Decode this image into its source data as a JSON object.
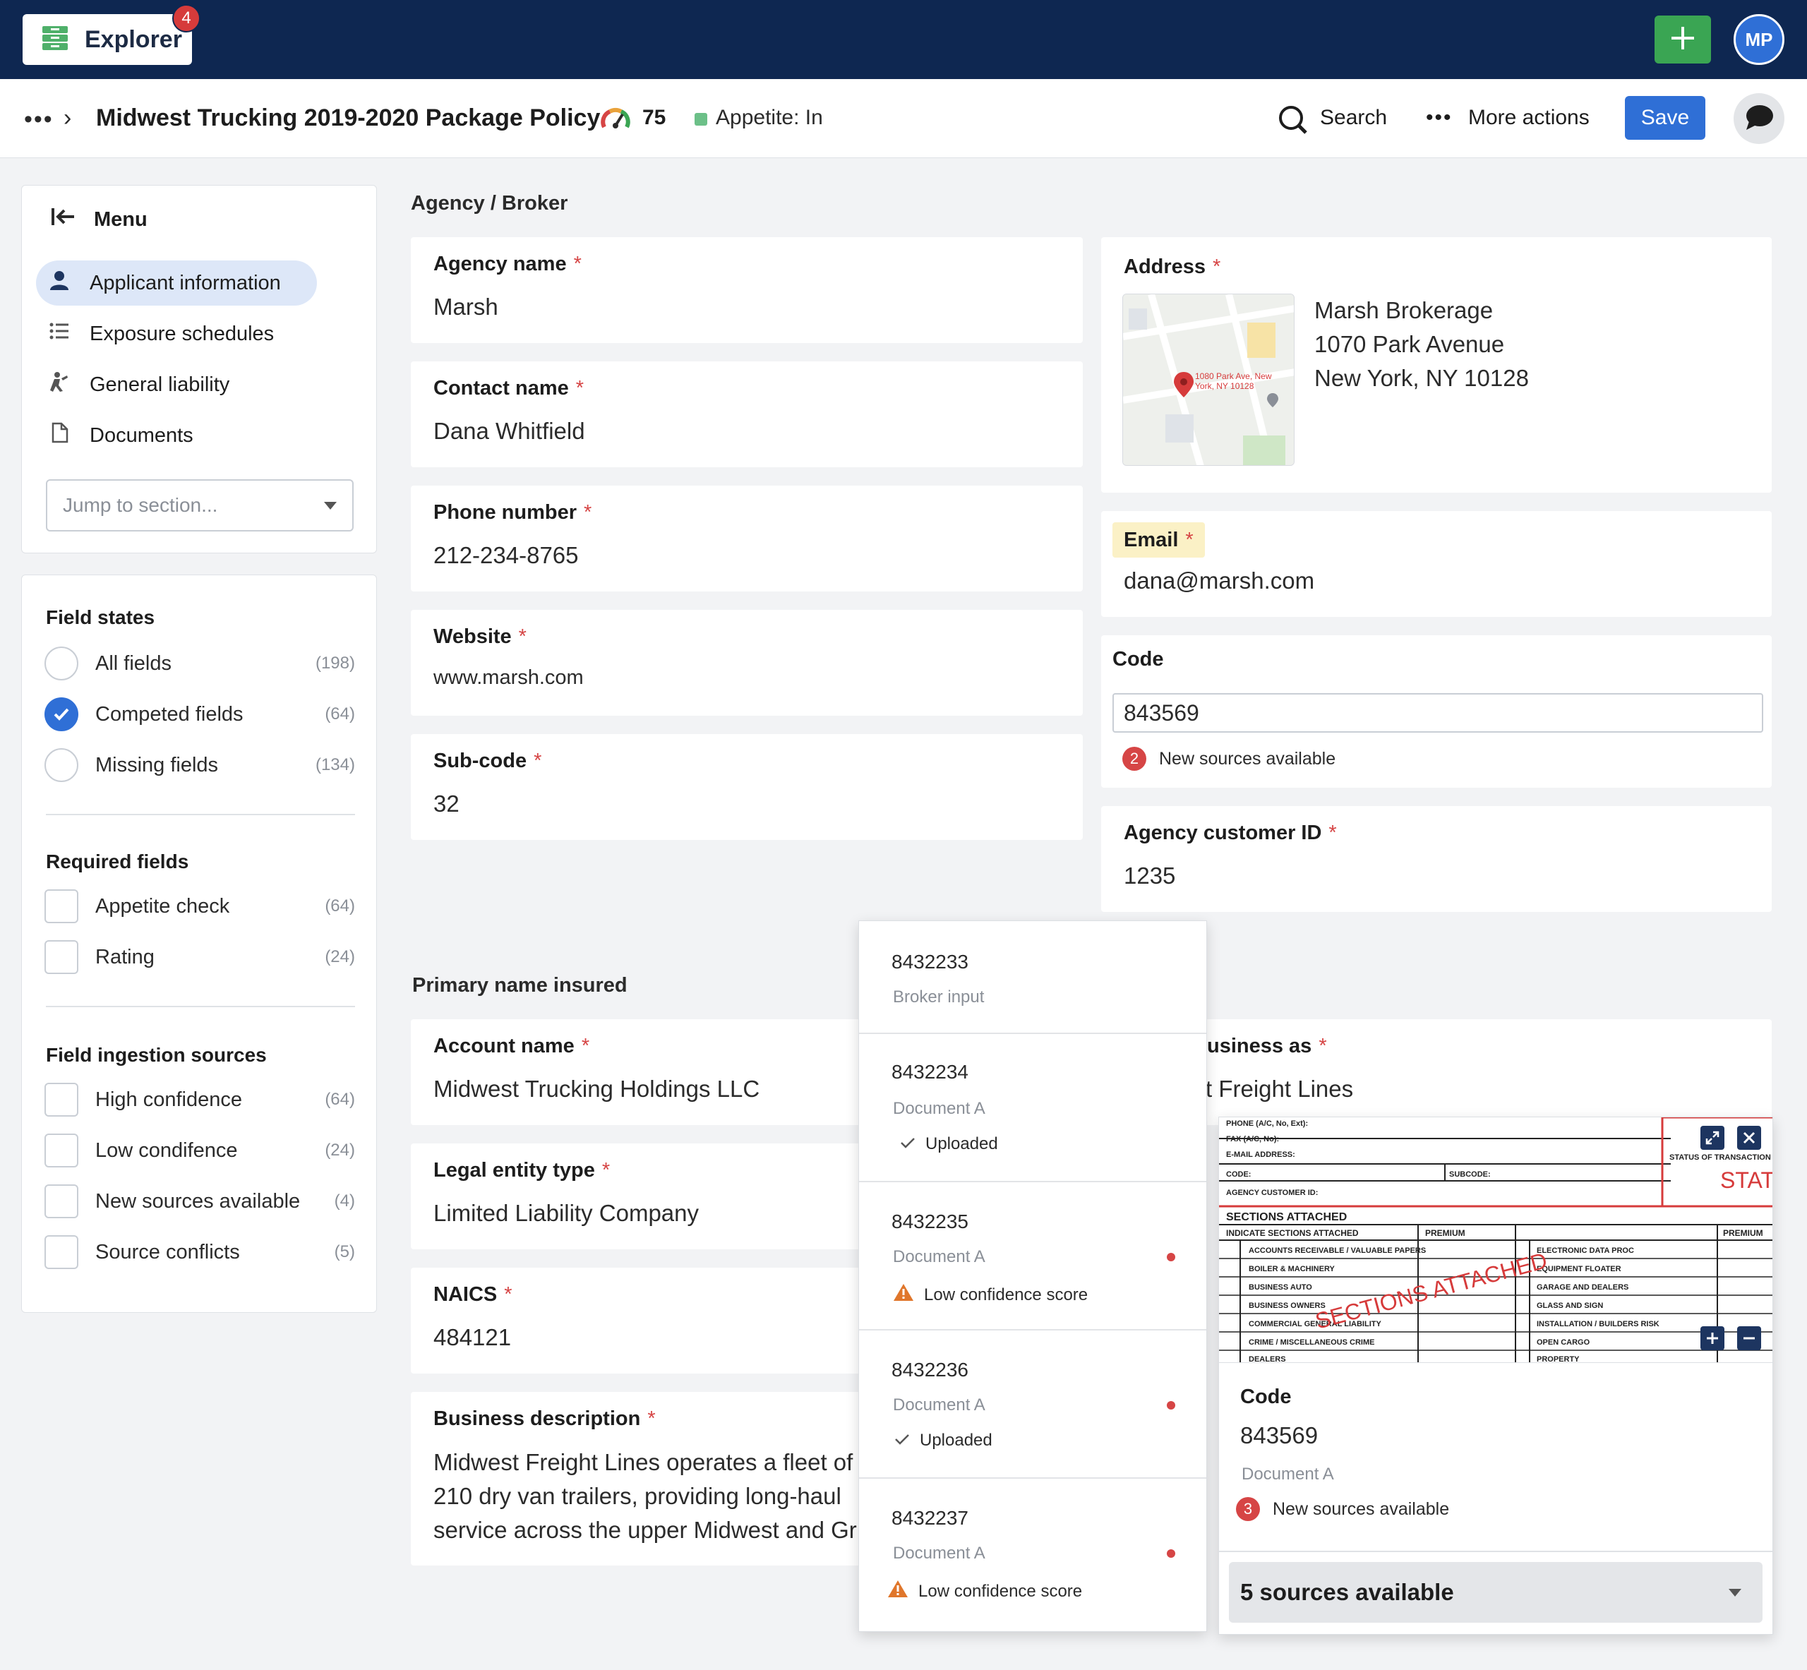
{
  "topbar": {
    "explorer_label": "Explorer",
    "explorer_badge": "4",
    "avatar_initials": "MP"
  },
  "header": {
    "title": "Midwest Trucking 2019-2020 Package Policy",
    "score": "75",
    "appetite": "Appetite: In",
    "search_label": "Search",
    "more_actions_label": "More actions",
    "save_label": "Save"
  },
  "menu": {
    "title": "Menu",
    "items": [
      {
        "label": "Applicant information",
        "icon": "person-icon"
      },
      {
        "label": "Exposure schedules",
        "icon": "list-icon"
      },
      {
        "label": "General liability",
        "icon": "liability-icon"
      },
      {
        "label": "Documents",
        "icon": "document-icon"
      }
    ],
    "jump_placeholder": "Jump to section..."
  },
  "field_states": {
    "title": "Field states",
    "options": [
      {
        "label": "All fields",
        "count": "(198)",
        "checked": false
      },
      {
        "label": "Competed fields",
        "count": "(64)",
        "checked": true
      },
      {
        "label": "Missing fields",
        "count": "(134)",
        "checked": false
      }
    ],
    "required_title": "Required fields",
    "required": [
      {
        "label": "Appetite check",
        "count": "(64)"
      },
      {
        "label": "Rating",
        "count": "(24)"
      }
    ],
    "ingestion_title": "Field ingestion sources",
    "ingestion": [
      {
        "label": "High confidence",
        "count": "(64)"
      },
      {
        "label": "Low condifence",
        "count": "(24)"
      },
      {
        "label": "New sources available",
        "count": "(4)"
      },
      {
        "label": "Source conflicts",
        "count": "(5)"
      }
    ]
  },
  "agency": {
    "section_title": "Agency / Broker",
    "agency_name_label": "Agency name",
    "agency_name": "Marsh",
    "contact_name_label": "Contact name",
    "contact_name": "Dana Whitfield",
    "phone_label": "Phone number",
    "phone": "212-234-8765",
    "website_label": "Website",
    "website": "www.marsh.com",
    "subcode_label": "Sub-code",
    "subcode": "32",
    "address_label": "Address",
    "address_lines": [
      "Marsh Brokerage",
      "1070 Park Avenue",
      "New York, NY 10128"
    ],
    "map_pin_text": "1080 Park Ave, New York, NY 10128",
    "email_label": "Email",
    "email": "dana@marsh.com",
    "code_label": "Code",
    "code": "843569",
    "code_sources_count": "2",
    "code_sources_text": "New sources available",
    "customer_id_label": "Agency customer ID",
    "customer_id": "1235"
  },
  "insured": {
    "section_title": "Primary name insured",
    "account_name_label": "Account name",
    "account_name": "Midwest Trucking Holdings LLC",
    "dba_label": "usiness as",
    "dba": "t Freight Lines",
    "entity_label": "Legal entity type",
    "entity": "Limited Liability Company",
    "naics_label": "NAICS",
    "naics": "484121",
    "desc_label": "Business description",
    "desc_lines": [
      "Midwest Freight Lines operates a fleet of",
      "210 dry van trailers, providing long-haul",
      "service across the upper Midwest and Gr"
    ]
  },
  "source_list": [
    {
      "code": "8432233",
      "source": "Broker input",
      "status": "",
      "status_type": "none",
      "dot": false
    },
    {
      "code": "8432234",
      "source": "Document A",
      "status": "Uploaded",
      "status_type": "check",
      "dot": false
    },
    {
      "code": "8432235",
      "source": "Document A",
      "status": "Low confidence score",
      "status_type": "warning",
      "dot": true
    },
    {
      "code": "8432236",
      "source": "Document A",
      "status": "Uploaded",
      "status_type": "check",
      "dot": true
    },
    {
      "code": "8432237",
      "source": "Document A",
      "status": "Low confidence score",
      "status_type": "warning",
      "dot": true
    }
  ],
  "source_popover": {
    "code_label": "Code",
    "code": "843569",
    "source": "Document A",
    "sources_count": "3",
    "sources_text": "New sources available",
    "select_label": "5 sources available",
    "doc_stamp": "SECTIONS ATTACHED",
    "doc_stamp2": "STAT",
    "doc_status_label": "STATUS OF TRANSACTION",
    "doc_section_header": "SECTIONS ATTACHED",
    "doc_indicate": "INDICATE SECTIONS ATTACHED",
    "doc_premium": "PREMIUM",
    "doc_rows_left": [
      "ACCOUNTS RECEIVABLE / VALUABLE PAPERS",
      "BOILER & MACHINERY",
      "BUSINESS AUTO",
      "BUSINESS OWNERS",
      "COMMERCIAL GENERAL LIABILITY",
      "CRIME / MISCELLANEOUS CRIME",
      "DEALERS"
    ],
    "doc_rows_right": [
      "ELECTRONIC DATA PROC",
      "EQUIPMENT FLOATER",
      "GARAGE AND DEALERS",
      "GLASS AND SIGN",
      "INSTALLATION / BUILDERS RISK",
      "OPEN CARGO",
      "PROPERTY"
    ],
    "doc_top_lines": [
      "PHONE (A/C, No, Ext):",
      "FAX (A/C, No):",
      "E-MAIL ADDRESS:"
    ],
    "doc_code": "CODE:",
    "doc_subcode": "SUBCODE:",
    "doc_customer": "AGENCY CUSTOMER ID:"
  },
  "colors": {
    "nav": "#0e2751",
    "accent": "#2f6fd6",
    "add": "#3aa553",
    "required": "#d64545",
    "highlight": "#fbf1c6"
  }
}
